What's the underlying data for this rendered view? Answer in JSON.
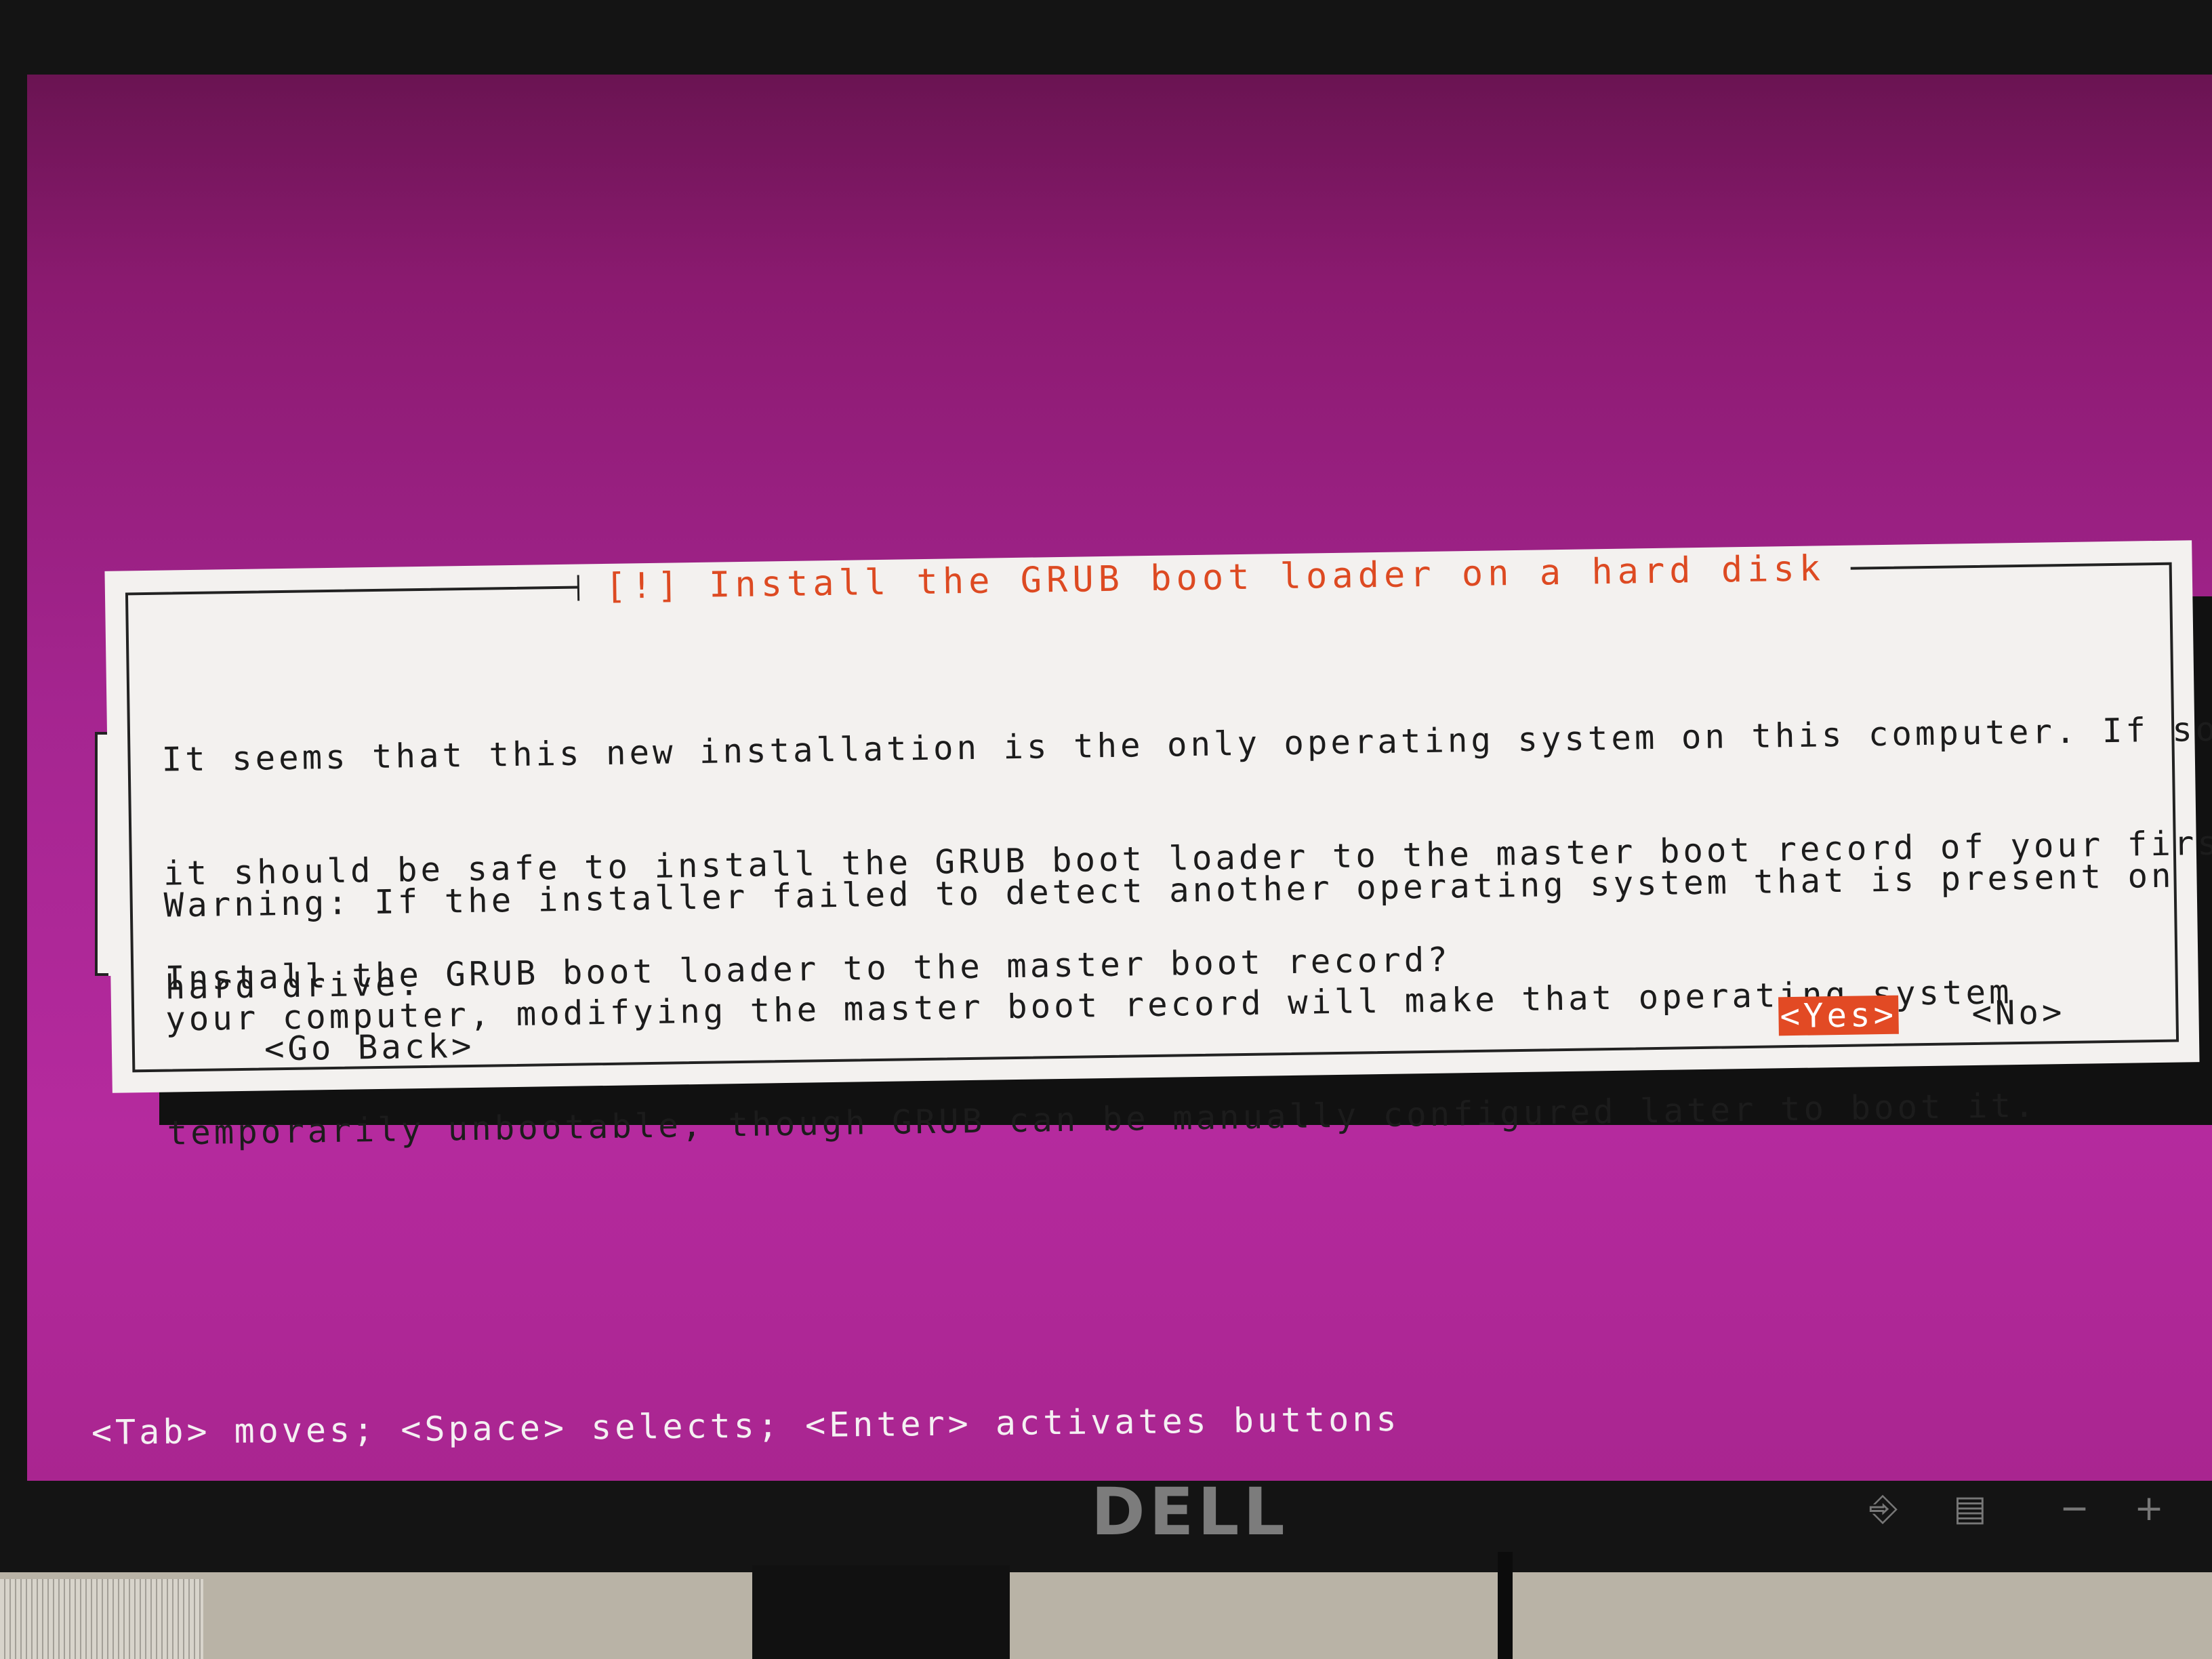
{
  "dialog": {
    "title": "[!] Install the GRUB boot loader on a hard disk",
    "paragraph1": [
      "It seems that this new installation is the only operating system on this computer. If so,",
      "it should be safe to install the GRUB boot loader to the master boot record of your first",
      "hard drive."
    ],
    "paragraph2": [
      "Warning: If the installer failed to detect another operating system that is present on",
      "your computer, modifying the master boot record will make that operating system",
      "temporarily unbootable, though GRUB can be manually configured later to boot it."
    ],
    "question": "Install the GRUB boot loader to the master boot record?",
    "buttons": {
      "go_back": "<Go Back>",
      "yes": "<Yes>",
      "no": "<No>"
    },
    "selected_button": "yes"
  },
  "help_line": "<Tab> moves; <Space> selects; <Enter> activates buttons",
  "monitor": {
    "brand": "DELL",
    "controls": [
      "input-source-icon",
      "menu-icon",
      "minus-icon",
      "plus-icon"
    ]
  },
  "colors": {
    "accent": "#e24a24",
    "title": "#dd4a22",
    "background_top": "#6a1452",
    "background_bottom": "#b52a9e",
    "dialog_bg": "#f3f1ef"
  }
}
